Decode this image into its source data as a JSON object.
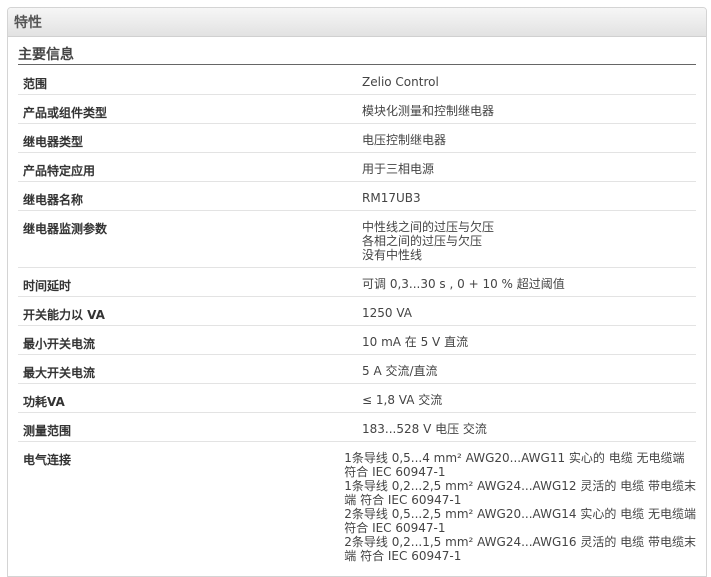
{
  "header": {
    "title": "特性"
  },
  "section": {
    "title": "主要信息"
  },
  "rows": [
    {
      "label": "范围",
      "values": [
        "Zelio Control"
      ]
    },
    {
      "label": "产品或组件类型",
      "values": [
        "模块化测量和控制继电器"
      ]
    },
    {
      "label": "继电器类型",
      "values": [
        "电压控制继电器"
      ]
    },
    {
      "label": "产品特定应用",
      "values": [
        "用于三相电源"
      ]
    },
    {
      "label": "继电器名称",
      "values": [
        "RM17UB3"
      ]
    },
    {
      "label": "继电器监测参数",
      "values": [
        "中性线之间的过压与欠压",
        "各相之间的过压与欠压",
        "没有中性线"
      ]
    },
    {
      "label": "时间延时",
      "values": [
        "可调 0,3...30 s , 0 + 10 % 超过阈值"
      ]
    },
    {
      "label": "开关能力以 VA",
      "values": [
        "1250 VA"
      ]
    },
    {
      "label": "最小开关电流",
      "values": [
        "10 mA 在 5 V 直流"
      ]
    },
    {
      "label": "最大开关电流",
      "values": [
        "5 A 交流/直流"
      ]
    },
    {
      "label": "功耗VA",
      "values": [
        "≤ 1,8 VA 交流"
      ]
    },
    {
      "label": "测量范围",
      "values": [
        "183...528 V 电压 交流"
      ]
    },
    {
      "label": "电气连接",
      "values": [
        "1条导线 0,5...4 mm² AWG20...AWG11 实心的 电缆 无电缆端",
        "符合 IEC 60947-1",
        "1条导线 0,2...2,5 mm² AWG24...AWG12 灵活的 电缆 带电缆末",
        "端 符合 IEC 60947-1",
        "2条导线 0,5...2,5 mm² AWG20...AWG14 实心的 电缆 无电缆端",
        "符合 IEC 60947-1",
        "2条导线 0,2...1,5 mm² AWG24...AWG16 灵活的 电缆 带电缆末",
        "端 符合 IEC 60947-1"
      ]
    }
  ]
}
